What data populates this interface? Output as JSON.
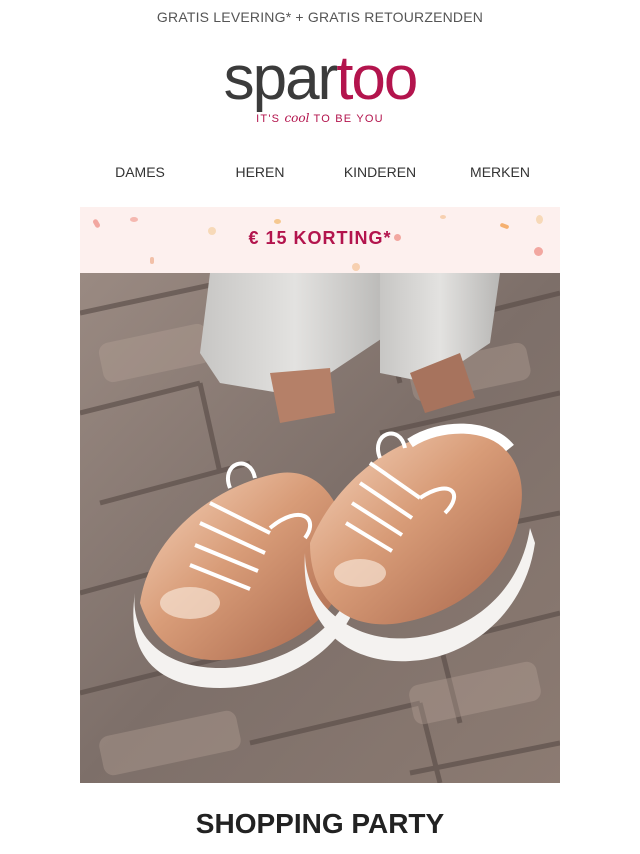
{
  "topbar": {
    "text": "GRATIS LEVERING* + GRATIS RETOURZENDEN"
  },
  "logo": {
    "word_dark": "spar",
    "word_accent": "too",
    "tagline_start": "IT'S",
    "tagline_cool": "cool",
    "tagline_end": "TO BE YOU",
    "accent_color": "#b3144d"
  },
  "nav": {
    "items": [
      {
        "label": "DAMES"
      },
      {
        "label": "HEREN"
      },
      {
        "label": "KINDEREN"
      },
      {
        "label": "MERKEN"
      }
    ]
  },
  "promo": {
    "text": "€ 15 KORTING*",
    "bg_color": "#fdf0ee"
  },
  "hero": {
    "image_icon": "sneakers-photo"
  },
  "headline": {
    "text": "SHOPPING PARTY"
  }
}
